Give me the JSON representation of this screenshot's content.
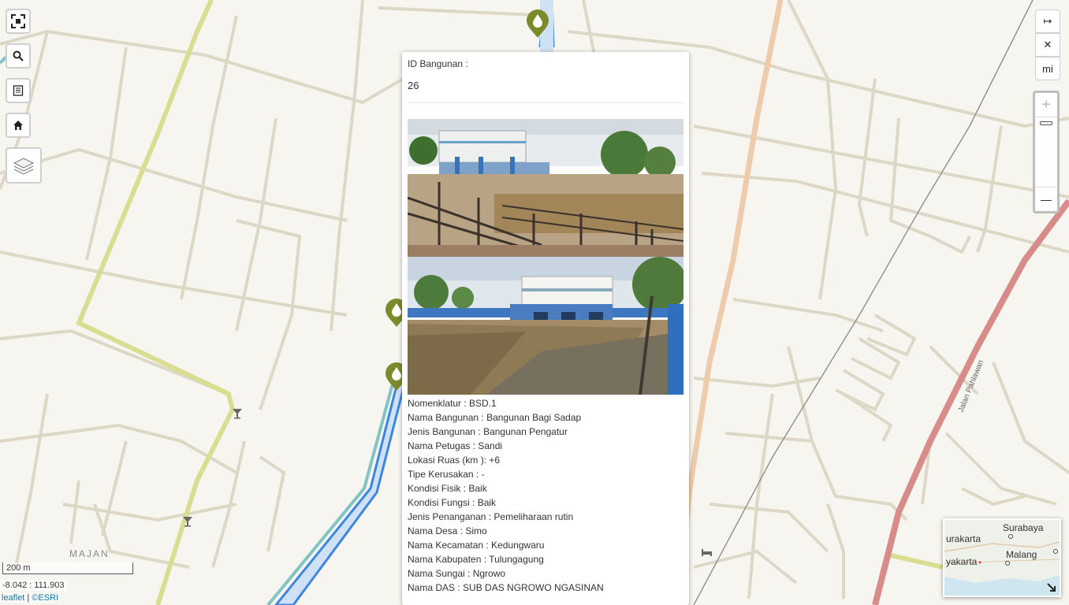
{
  "map": {
    "place_label": "MAJAN",
    "road_label": "Jalan Pahlawan"
  },
  "controls": {
    "fullscreen_icon": "fullscreen-icon",
    "search_icon": "search-icon",
    "list_icon": "list-icon",
    "home_icon": "home-icon",
    "layers_icon": "layers-icon",
    "measure_label": "↦",
    "close_label": "✕",
    "unit_label": "mi",
    "zoom_in_label": "+",
    "zoom_out_label": "—"
  },
  "popup": {
    "id_label": "ID Bangunan :",
    "id_value": "26",
    "attributes": [
      "Nomenklatur : BSD.1",
      "Nama Bangunan : Bangunan Bagi Sadap",
      "Jenis Bangunan : Bangunan Pengatur",
      "Nama Petugas : Sandi",
      "Lokasi Ruas (km ): +6",
      "Tipe Kerusakan : -",
      "Kondisi Fisik : Baik",
      "Kondisi Fungsi : Baik",
      "Jenis Penanganan : Pemeliharaan rutin",
      "Nama Desa : Simo",
      "Nama Kecamatan : Kedungwaru",
      "Nama Kabupaten : Tulungagung",
      "Nama Sungai : Ngrowo",
      "Nama DAS : SUB DAS NGROWO NGASINAN"
    ]
  },
  "scale": {
    "label": "200 m"
  },
  "coords": {
    "text": "-8.042 : 111.903"
  },
  "attribution": {
    "leaflet": "leaflet",
    "sep": " | ",
    "esri": "©ESRI"
  },
  "minimap": {
    "labels": [
      "Surabaya",
      "urakarta",
      "Malang",
      "yakarta"
    ]
  },
  "colors": {
    "marker": "#7a8b2a",
    "river": "#3d86e0",
    "road_green": "#d7dc8e",
    "road_red": "#d98a88",
    "road_orange": "#eccaa8",
    "road_minor": "#e3ddcd"
  }
}
